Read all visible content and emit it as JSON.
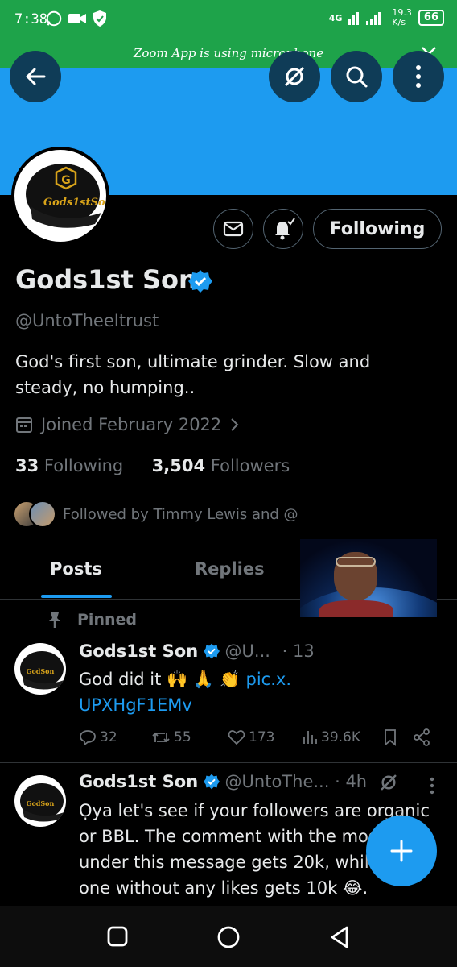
{
  "status_bar": {
    "time": "7:38",
    "network": "4G",
    "speed": "19.3",
    "speed_unit": "K/s",
    "battery": "66"
  },
  "zoom_banner": {
    "text": "Zoom App is using microphone"
  },
  "profile": {
    "display_name": "Gods1st Son",
    "handle": "@UntoTheeItrust",
    "bio": "God's first son, ultimate grinder. Slow and steady, no humping..",
    "joined": "Joined February 2022",
    "following_count": "33",
    "following_label": "Following",
    "followers_count": "3,504",
    "followers_label": "Followers",
    "followed_by": "Followed by Timmy Lewis and @",
    "follow_button": "Following",
    "avatar_text": "Gods1stSon"
  },
  "tabs": {
    "posts": "Posts",
    "replies": "Replies"
  },
  "colors": {
    "accent": "#1d9bf0",
    "status_green": "#1ea34a"
  },
  "tweets": [
    {
      "pinned_label": "Pinned",
      "name": "Gods1st Son",
      "handle": "@U...",
      "time": "· 13",
      "body_text": "God did it 🙌 🙏 👏 ",
      "link1": "pic.x.",
      "link2": "UPXHgF1EMv",
      "replies": "32",
      "retweets": "55",
      "likes": "173",
      "views": "39.6K"
    },
    {
      "name": "Gods1st Son",
      "handle": "@UntoThe...",
      "time": "· 4h",
      "body": "Ọya let's see if your followers are organic or BBL. The comment with the most likes under this message gets 20k, while ONLY one without any likes gets 10k 😂."
    }
  ],
  "icons": [
    "back-arrow-icon",
    "grok-icon",
    "search-icon",
    "more-vertical-icon",
    "mail-icon",
    "bell-check-icon",
    "verified-badge-icon",
    "calendar-icon",
    "chevron-right-icon",
    "pin-icon",
    "reply-icon",
    "retweet-icon",
    "like-icon",
    "views-icon",
    "bookmark-icon",
    "share-icon",
    "compose-plus-icon",
    "recents-icon",
    "home-icon",
    "back-nav-icon"
  ]
}
